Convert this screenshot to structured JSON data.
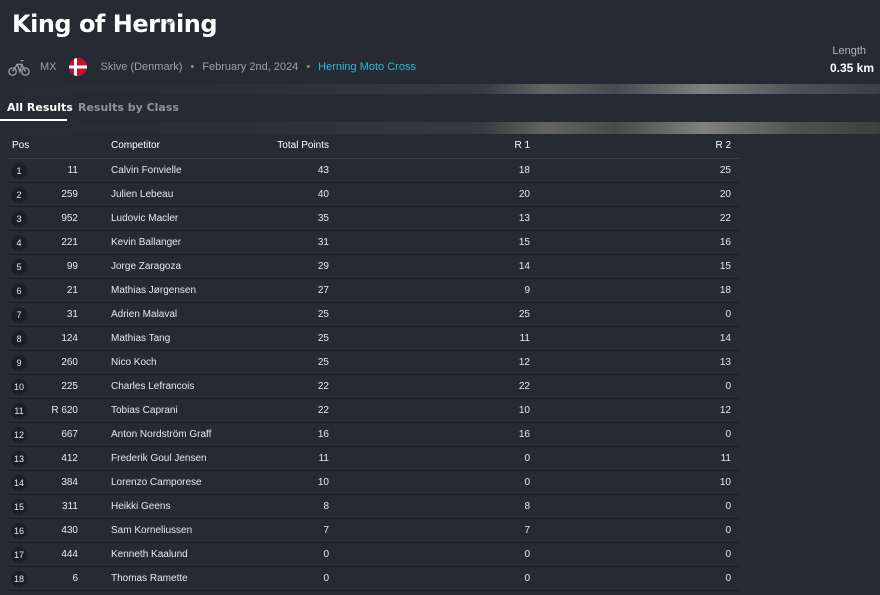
{
  "event": {
    "title": "King of Herning",
    "sport": "MX",
    "location": "Skive (Denmark)",
    "date": "February 2nd, 2024",
    "venue": "Herning Moto Cross",
    "length_label": "Length",
    "length_value": "0.35 km"
  },
  "icons": {
    "sport": "bicycle-icon",
    "flag": "denmark-flag-icon",
    "dropdown": "chevron-down-icon"
  },
  "colors": {
    "accent": "#2fb8d6",
    "background": "#262b33"
  },
  "tabs": [
    {
      "label": "All Results",
      "active": true
    },
    {
      "label": "Results by Class",
      "active": false
    }
  ],
  "table": {
    "headers": {
      "pos": "Pos",
      "competitor": "Competitor",
      "total": "Total Points",
      "r1": "R 1",
      "r2": "R 2"
    },
    "rows": [
      {
        "pos": "1",
        "num": "11",
        "name": "Calvin Fonvielle",
        "total": "43",
        "r1": "18",
        "r2": "25"
      },
      {
        "pos": "2",
        "num": "259",
        "name": "Julien Lebeau",
        "total": "40",
        "r1": "20",
        "r2": "20"
      },
      {
        "pos": "3",
        "num": "952",
        "name": "Ludovic Macler",
        "total": "35",
        "r1": "13",
        "r2": "22"
      },
      {
        "pos": "4",
        "num": "221",
        "name": "Kevin Ballanger",
        "total": "31",
        "r1": "15",
        "r2": "16"
      },
      {
        "pos": "5",
        "num": "99",
        "name": "Jorge Zaragoza",
        "total": "29",
        "r1": "14",
        "r2": "15"
      },
      {
        "pos": "6",
        "num": "21",
        "name": "Mathias Jørgensen",
        "total": "27",
        "r1": "9",
        "r2": "18"
      },
      {
        "pos": "7",
        "num": "31",
        "name": "Adrien Malaval",
        "total": "25",
        "r1": "25",
        "r2": "0"
      },
      {
        "pos": "8",
        "num": "124",
        "name": "Mathias Tang",
        "total": "25",
        "r1": "11",
        "r2": "14"
      },
      {
        "pos": "9",
        "num": "260",
        "name": "Nico Koch",
        "total": "25",
        "r1": "12",
        "r2": "13"
      },
      {
        "pos": "10",
        "num": "225",
        "name": "Charles Lefrancois",
        "total": "22",
        "r1": "22",
        "r2": "0"
      },
      {
        "pos": "11",
        "num": "R 620",
        "name": "Tobias Caprani",
        "total": "22",
        "r1": "10",
        "r2": "12"
      },
      {
        "pos": "12",
        "num": "667",
        "name": "Anton Nordström Graff",
        "total": "16",
        "r1": "16",
        "r2": "0"
      },
      {
        "pos": "13",
        "num": "412",
        "name": "Frederik Goul Jensen",
        "total": "11",
        "r1": "0",
        "r2": "11"
      },
      {
        "pos": "14",
        "num": "384",
        "name": "Lorenzo Camporese",
        "total": "10",
        "r1": "0",
        "r2": "10"
      },
      {
        "pos": "15",
        "num": "311",
        "name": "Heikki Geens",
        "total": "8",
        "r1": "8",
        "r2": "0"
      },
      {
        "pos": "16",
        "num": "430",
        "name": "Sam Korneliussen",
        "total": "7",
        "r1": "7",
        "r2": "0"
      },
      {
        "pos": "17",
        "num": "444",
        "name": "Kenneth Kaalund",
        "total": "0",
        "r1": "0",
        "r2": "0"
      },
      {
        "pos": "18",
        "num": "6",
        "name": "Thomas Ramette",
        "total": "0",
        "r1": "0",
        "r2": "0"
      }
    ]
  }
}
